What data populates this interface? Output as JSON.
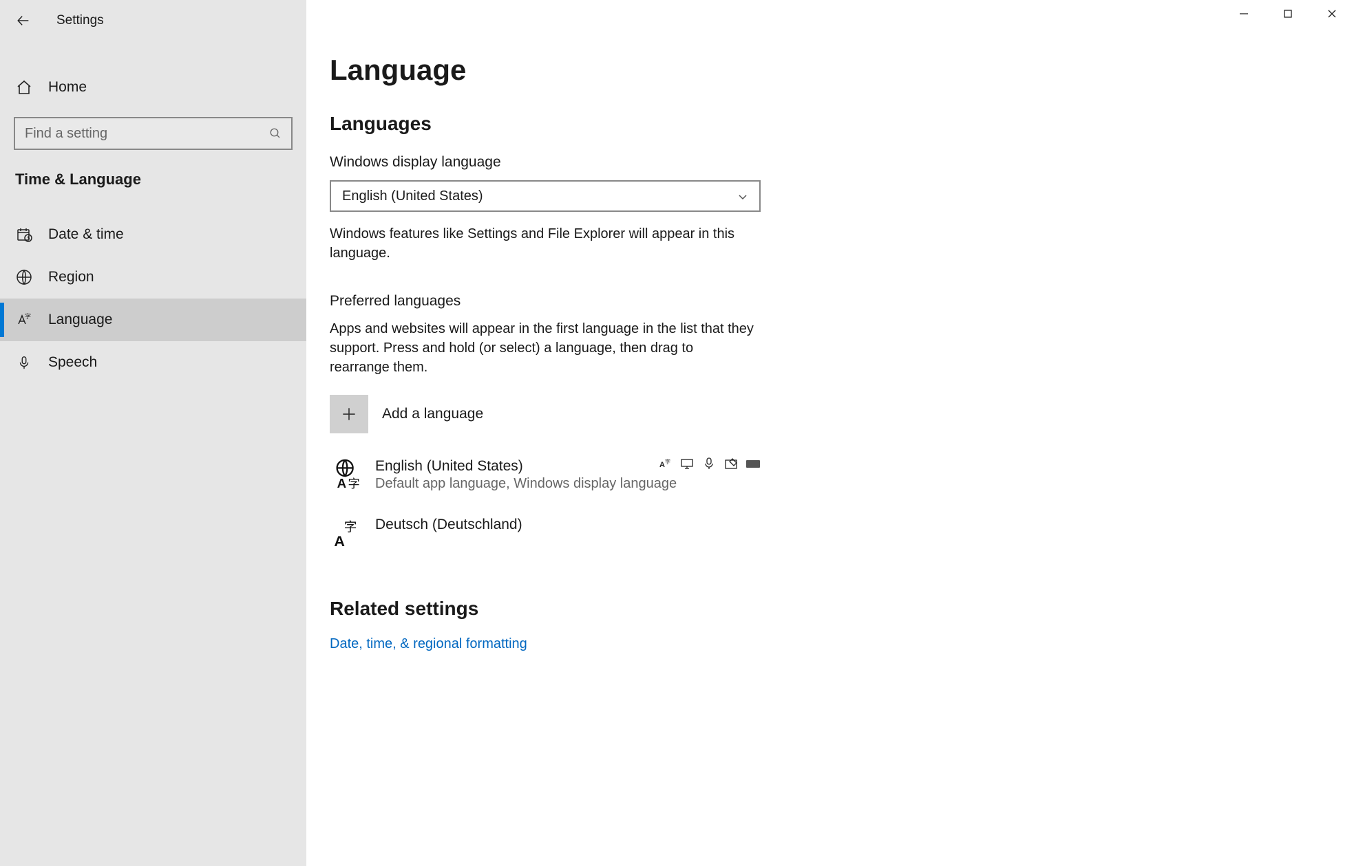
{
  "app_title": "Settings",
  "window": {
    "minimize": "Minimize",
    "maximize": "Maximize",
    "close": "Close"
  },
  "sidebar": {
    "home_label": "Home",
    "search_placeholder": "Find a setting",
    "category": "Time & Language",
    "items": [
      {
        "id": "date-time",
        "label": "Date & time"
      },
      {
        "id": "region",
        "label": "Region"
      },
      {
        "id": "language",
        "label": "Language",
        "active": true
      },
      {
        "id": "speech",
        "label": "Speech"
      }
    ]
  },
  "page": {
    "title": "Language",
    "languages_heading": "Languages",
    "display_language_label": "Windows display language",
    "display_language_value": "English (United States)",
    "display_language_desc": "Windows features like Settings and File Explorer will appear in this language.",
    "preferred_heading": "Preferred languages",
    "preferred_desc": "Apps and websites will appear in the first language in the list that they support. Press and hold (or select) a language, then drag to rearrange them.",
    "add_language_label": "Add a language",
    "languages": [
      {
        "name": "English (United States)",
        "subtitle": "Default app language, Windows display language",
        "caps": [
          "display",
          "desktop",
          "voice",
          "handwriting",
          "keyboard"
        ]
      },
      {
        "name": "Deutsch (Deutschland)",
        "subtitle": "",
        "caps": []
      }
    ],
    "related_heading": "Related settings",
    "related_link": "Date, time, & regional formatting"
  }
}
